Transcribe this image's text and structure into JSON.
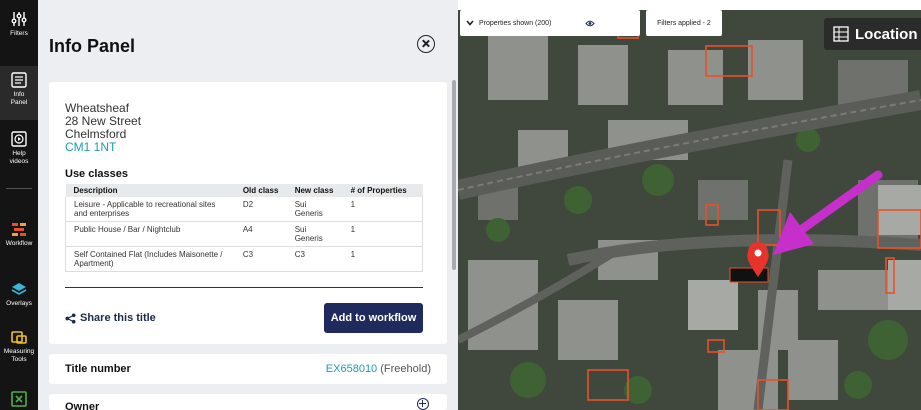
{
  "rail": {
    "items": [
      {
        "label": "Filters",
        "icon": "filters-icon"
      },
      {
        "label": "Info Panel",
        "icon": "info-panel-icon"
      },
      {
        "label": "Help videos",
        "icon": "help-videos-icon"
      },
      {
        "label": "Workflow",
        "icon": "workflow-icon"
      },
      {
        "label": "Overlays",
        "icon": "overlays-icon"
      },
      {
        "label": "Measuring Tools",
        "icon": "measuring-tools-icon"
      },
      {
        "label": "",
        "icon": "excel-icon"
      }
    ]
  },
  "panel": {
    "title": "Info Panel",
    "address": {
      "line1": "Wheatsheaf",
      "line2": "28 New Street",
      "line3": "Chelmsford",
      "postcode": "CM1 1NT"
    },
    "use_classes": {
      "title": "Use classes",
      "headers": [
        "Description",
        "Old class",
        "New class",
        "# of Properties"
      ],
      "rows": [
        [
          "Leisure - Applicable to recreational sites and enterprises",
          "D2",
          "Sui Generis",
          "1"
        ],
        [
          "Public House / Bar / Nightclub",
          "A4",
          "Sui Generis",
          "1"
        ],
        [
          "Self Contained Flat (Includes Maisonette / Apartment)",
          "C3",
          "C3",
          "1"
        ]
      ]
    },
    "share_label": "Share this title",
    "workflow_button": "Add to workflow",
    "title_number": {
      "label": "Title number",
      "number": "EX658010",
      "tenure": "(Freehold)"
    },
    "owner_label": "Owner"
  },
  "map": {
    "properties_shown": "Properties shown (200)",
    "filters_applied": "Filters applied - 2",
    "location_label": "Location",
    "colors": {
      "marker": "#e8332a",
      "arrow": "#c62fc9",
      "boundary": "#e8502a"
    }
  }
}
